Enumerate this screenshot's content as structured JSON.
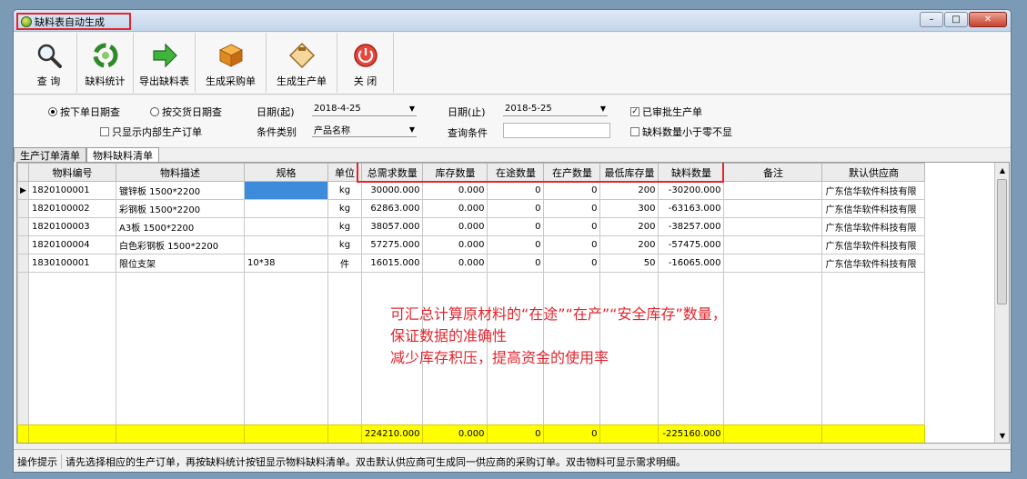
{
  "window": {
    "title": "缺料表自动生成",
    "buttons": {
      "minimize": "–",
      "maximize": "□",
      "close": "✕"
    }
  },
  "toolbar": [
    {
      "label": "查 询",
      "icon": "magnifier-icon"
    },
    {
      "label": "缺料统计",
      "icon": "recycle-icon"
    },
    {
      "label": "导出缺料表",
      "icon": "green-arrow-icon"
    },
    {
      "label": "生成采购单",
      "icon": "package-icon"
    },
    {
      "label": "生成生产单",
      "icon": "clipboard-icon"
    },
    {
      "label": "关 闭",
      "icon": "power-icon"
    }
  ],
  "filters": {
    "radio_order_date": "按下单日期查",
    "radio_delivery_date": "按交货日期查",
    "internal_only": "只显示内部生产订单",
    "date_from_label": "日期(起)",
    "date_from": "2018-4-25",
    "date_to_label": "日期(止)",
    "date_to": "2018-5-25",
    "category_label": "条件类别",
    "category_value": "产品名称",
    "condition_label": "查询条件",
    "approved_label": "已审批生产单",
    "hide_negative_label": "缺料数量小于零不显"
  },
  "tabs": [
    "生产订单清单",
    "物料缺料清单"
  ],
  "table": {
    "columns": [
      "物料编号",
      "物料描述",
      "规格",
      "单位",
      "总需求数量",
      "库存数量",
      "在途数量",
      "在产数量",
      "最低库存量",
      "缺料数量",
      "备注",
      "默认供应商"
    ],
    "rows": [
      [
        "1820100001",
        "镀锌板 1500*2200",
        "",
        "kg",
        "30000.000",
        "0.000",
        "0",
        "0",
        "200",
        "-30200.000",
        "",
        "广东信华软件科技有限"
      ],
      [
        "1820100002",
        "彩钢板 1500*2200",
        "",
        "kg",
        "62863.000",
        "0.000",
        "0",
        "0",
        "300",
        "-63163.000",
        "",
        "广东信华软件科技有限"
      ],
      [
        "1820100003",
        "A3板 1500*2200",
        "",
        "kg",
        "38057.000",
        "0.000",
        "0",
        "0",
        "200",
        "-38257.000",
        "",
        "广东信华软件科技有限"
      ],
      [
        "1820100004",
        "白色彩钢板 1500*2200",
        "",
        "kg",
        "57275.000",
        "0.000",
        "0",
        "0",
        "200",
        "-57475.000",
        "",
        "广东信华软件科技有限"
      ],
      [
        "1830100001",
        "限位支架",
        "10*38",
        "件",
        "16015.000",
        "0.000",
        "0",
        "0",
        "50",
        "-16065.000",
        "",
        "广东信华软件科技有限"
      ]
    ],
    "totals": [
      "",
      "",
      "",
      "",
      "224210.000",
      "0.000",
      "0",
      "0",
      "",
      "-225160.000",
      "",
      ""
    ]
  },
  "annotation": {
    "line1": "可汇总计算原材料的“在途”“在产”“安全库存”数量，",
    "line2": "保证数据的准确性",
    "line3": "减少库存积压，提高资金的使用率"
  },
  "statusbar": {
    "label": "操作提示",
    "message": "请先选择相应的生产订单，再按缺料统计按钮显示物料缺料清单。双击默认供应商可生成同一供应商的采购订单。双击物料可显示需求明细。"
  },
  "colors": {
    "accent_red": "#e0262e",
    "total_row": "#ffff00",
    "selected_cell": "#3d8cdc"
  }
}
